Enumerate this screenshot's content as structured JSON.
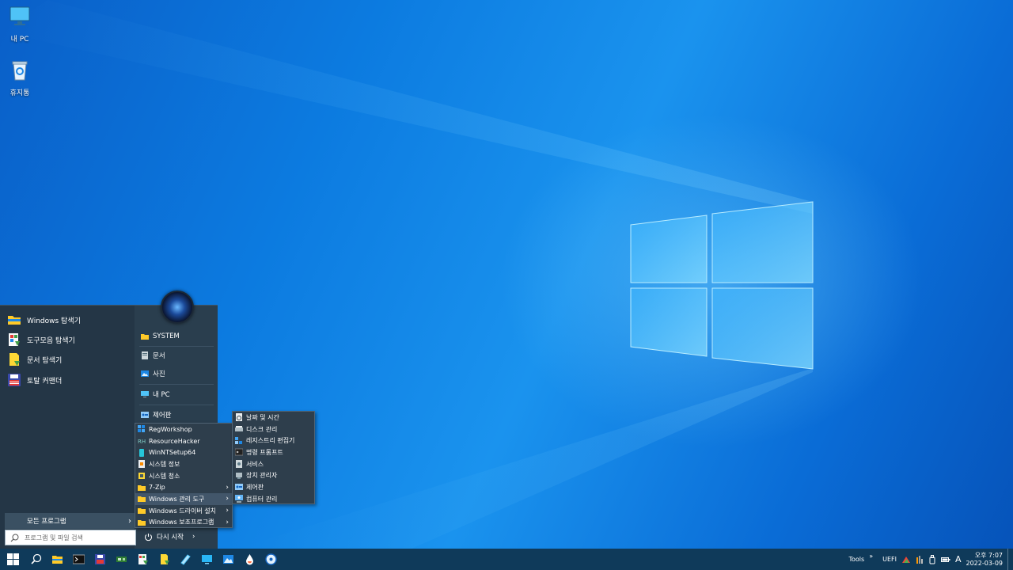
{
  "desktop": {
    "icons": [
      {
        "label": "내 PC",
        "icon": "monitor-icon"
      },
      {
        "label": "휴지통",
        "icon": "recycle-bin-icon"
      }
    ]
  },
  "start_menu": {
    "pinned": [
      {
        "label": "Windows 탐색기",
        "icon": "folder-explorer-icon"
      },
      {
        "label": "도구모음 탐색기",
        "icon": "toolbar-explorer-icon"
      },
      {
        "label": "문서 탐색기",
        "icon": "document-explorer-icon"
      },
      {
        "label": "토탈 커맨더",
        "icon": "floppy-disk-icon"
      }
    ],
    "right_items": [
      {
        "label": "SYSTEM",
        "icon": "folder-icon"
      },
      {
        "label": "문서",
        "icon": "document-icon"
      },
      {
        "label": "사진",
        "icon": "picture-icon"
      },
      {
        "label": "내 PC",
        "icon": "monitor-icon"
      },
      {
        "label": "제어판",
        "icon": "control-panel-icon"
      }
    ],
    "all_programs": "모든 프로그램",
    "search_placeholder": "프로그램 및 파일 검색",
    "restart": "다시 시작"
  },
  "programs_submenu": [
    {
      "label": "RegWorkshop",
      "icon": "regworkshop-icon",
      "arrow": ""
    },
    {
      "label": "ResourceHacker",
      "icon": "resourcehacker-icon",
      "arrow": ""
    },
    {
      "label": "WinNTSetup64",
      "icon": "winntsetup-icon",
      "arrow": ""
    },
    {
      "label": "시스템 정보",
      "icon": "system-info-icon",
      "arrow": ""
    },
    {
      "label": "시스템 청소",
      "icon": "system-clean-icon",
      "arrow": ""
    },
    {
      "label": "7-Zip",
      "icon": "folder-icon",
      "arrow": ">"
    },
    {
      "label": "Windows 관리 도구",
      "icon": "folder-icon",
      "arrow": ">"
    },
    {
      "label": "Windows 드라이버 설치",
      "icon": "folder-icon",
      "arrow": ">"
    },
    {
      "label": "Windows 보조프로그램",
      "icon": "folder-icon",
      "arrow": ">"
    }
  ],
  "admin_tools_submenu": [
    {
      "label": "날짜 및 시간",
      "icon": "date-time-icon"
    },
    {
      "label": "디스크 관리",
      "icon": "disk-management-icon"
    },
    {
      "label": "레지스트리 편집기",
      "icon": "registry-editor-icon"
    },
    {
      "label": "명령 프롬프트",
      "icon": "command-prompt-icon"
    },
    {
      "label": "서비스",
      "icon": "services-icon"
    },
    {
      "label": "장치 관리자",
      "icon": "device-manager-icon"
    },
    {
      "label": "제어판",
      "icon": "control-panel-icon"
    },
    {
      "label": "컴퓨터 관리",
      "icon": "computer-management-icon"
    }
  ],
  "taskbar": {
    "apps": [
      "start-icon",
      "search-icon",
      "file-explorer-icon",
      "terminal-icon",
      "floppy-disk-icon",
      "network-card-icon",
      "toolbar-explorer-icon",
      "document-explorer-icon",
      "pen-icon",
      "display-icon",
      "photos-icon",
      "drop-icon",
      "disc-icon"
    ],
    "tray": {
      "tools": "Tools",
      "chevron": "»",
      "uefi": "UEFI",
      "ime": "A",
      "time": "오후 7:07",
      "date": "2022-03-09"
    }
  },
  "colors": {
    "start_bg": "#2a3e4e",
    "taskbar_bg": "#0f3a5a",
    "desktop_blue": "#0c7be0"
  }
}
